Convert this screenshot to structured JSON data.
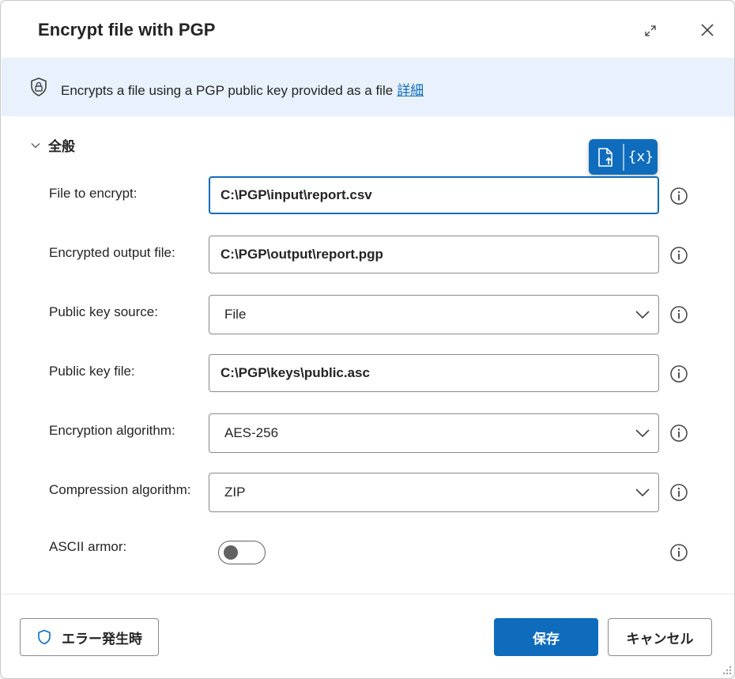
{
  "dialog": {
    "title": "Encrypt file with PGP"
  },
  "banner": {
    "description": "Encrypts a file using a PGP public key provided as a file",
    "link": "詳細"
  },
  "section": {
    "label": "全般"
  },
  "fields": {
    "file_to_encrypt": {
      "label": "File to encrypt:",
      "value": "C:\\PGP\\input\\report.csv"
    },
    "encrypted_output_file": {
      "label": "Encrypted output file:",
      "value": "C:\\PGP\\output\\report.pgp"
    },
    "public_key_source": {
      "label": "Public key source:",
      "value": "File"
    },
    "public_key_file": {
      "label": "Public key file:",
      "value": "C:\\PGP\\keys\\public.asc"
    },
    "encryption_algorithm": {
      "label": "Encryption algorithm:",
      "value": "AES-256"
    },
    "compression_algorithm": {
      "label": "Compression algorithm:",
      "value": "ZIP"
    },
    "ascii_armor": {
      "label": "ASCII armor:",
      "enabled": false
    }
  },
  "toolbar": {
    "variable_symbol": "{x}"
  },
  "footer": {
    "on_error_label": "エラー発生時",
    "save_label": "保存",
    "cancel_label": "キャンセル"
  },
  "colors": {
    "accent": "#0f6cbd",
    "banner_bg": "#e8f1fc",
    "border": "#8a8a8a"
  }
}
